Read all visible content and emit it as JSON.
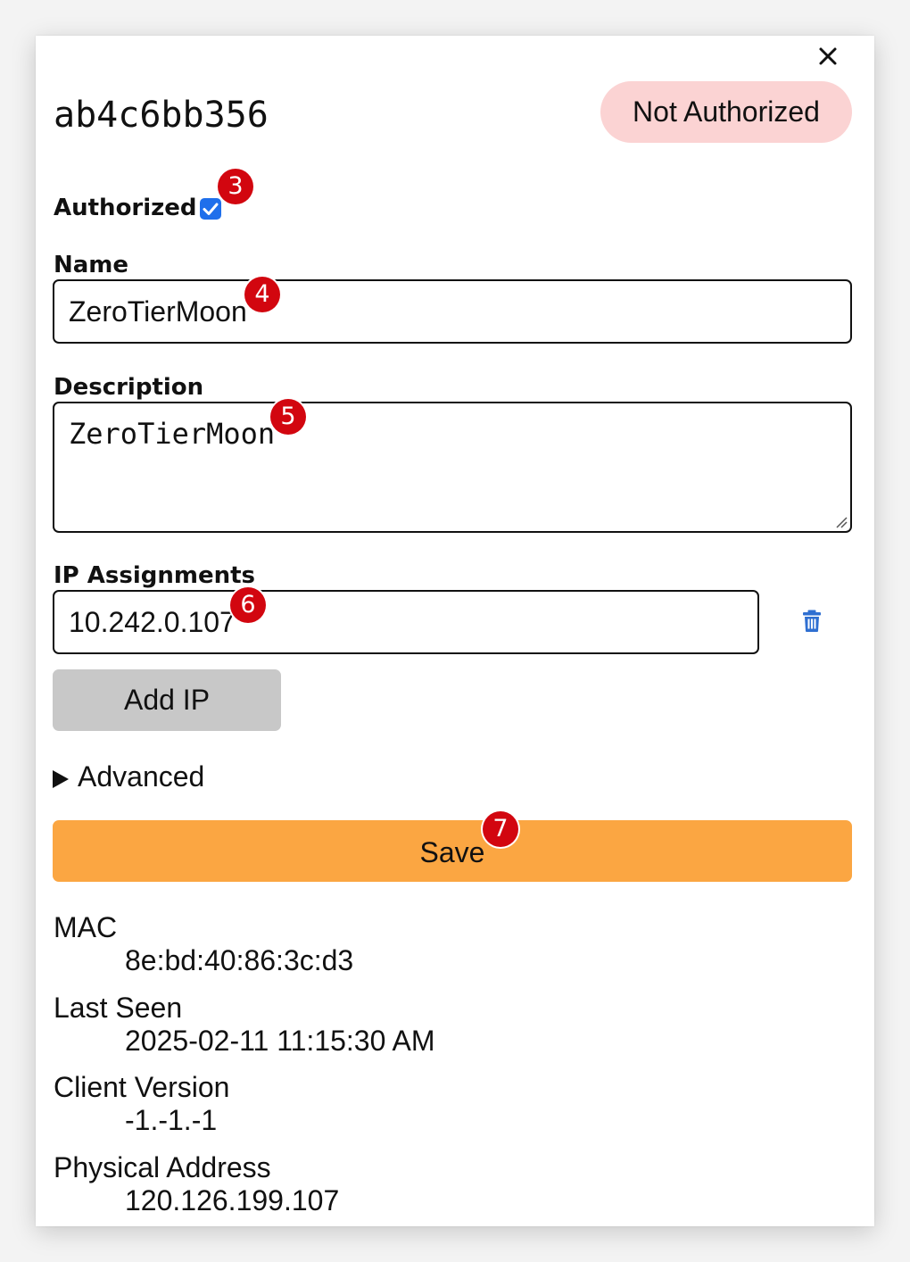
{
  "modal": {
    "close_label": "×",
    "node_id": "ab4c6bb356",
    "status_badge": "Not Authorized",
    "colors": {
      "badge_bg": "#fbd3d3",
      "checkbox": "#1f6feb",
      "save_bg": "#fba642",
      "add_ip_bg": "#c8c8c8",
      "trash_icon": "#2f6fd1",
      "marker": "#d2060f"
    }
  },
  "form": {
    "authorized_label": "Authorized",
    "authorized_checked": true,
    "name_label": "Name",
    "name_value": "ZeroTierMoon",
    "description_label": "Description",
    "description_value": "ZeroTierMoon",
    "ip_label": "IP Assignments",
    "ip_value": "10.242.0.107",
    "add_ip_label": "Add IP",
    "advanced_label": "Advanced",
    "save_label": "Save"
  },
  "markers": [
    "3",
    "4",
    "5",
    "6",
    "7"
  ],
  "info": [
    {
      "label": "MAC",
      "value": "8e:bd:40:86:3c:d3"
    },
    {
      "label": "Last Seen",
      "value": "2025-02-11 11:15:30 AM"
    },
    {
      "label": "Client Version",
      "value": "-1.-1.-1"
    },
    {
      "label": "Physical Address",
      "value": "120.126.199.107"
    }
  ],
  "icons": {
    "close": "close-icon",
    "checkbox": "checkmark-icon",
    "trash": "trash-icon",
    "advanced": "triangle-right-icon"
  }
}
